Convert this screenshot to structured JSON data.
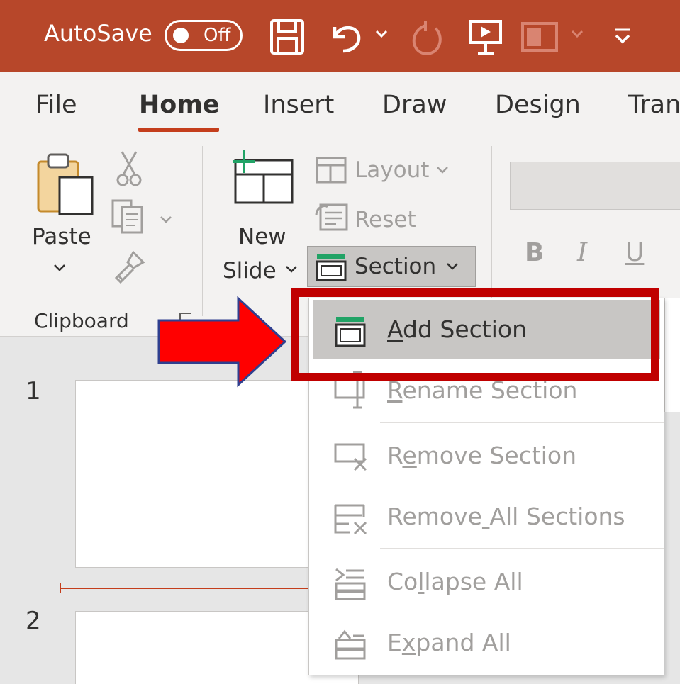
{
  "titlebar": {
    "autosave_label": "AutoSave",
    "autosave_state": "Off",
    "background": "#b7472a",
    "icons": [
      "save-icon",
      "undo-icon",
      "redo-icon",
      "present-icon",
      "layout-icon",
      "customize-icon"
    ]
  },
  "tabs": [
    {
      "label": "File",
      "active": false
    },
    {
      "label": "Home",
      "active": true
    },
    {
      "label": "Insert",
      "active": false
    },
    {
      "label": "Draw",
      "active": false
    },
    {
      "label": "Design",
      "active": false
    },
    {
      "label": "Tran",
      "active": false
    }
  ],
  "ribbon": {
    "clipboard": {
      "paste_label": "Paste",
      "group_label": "Clipboard"
    },
    "slides": {
      "new_slide_line1": "New",
      "new_slide_line2": "Slide",
      "layout_label": "Layout",
      "reset_label": "Reset",
      "section_label": "Section"
    },
    "font": {
      "bold": "B",
      "italic": "I",
      "underline": "U"
    }
  },
  "slides": [
    {
      "number": "1"
    },
    {
      "number": "2"
    }
  ],
  "section_menu": {
    "items": [
      {
        "label": "Add Section",
        "enabled": true,
        "highlighted": true
      },
      {
        "label": "Rename Section",
        "enabled": false
      },
      {
        "label": "Remove Section",
        "enabled": false
      },
      {
        "label": "Remove All Sections",
        "enabled": false
      },
      {
        "label": "Collapse All",
        "enabled": false
      },
      {
        "label": "Expand All",
        "enabled": false
      }
    ]
  },
  "colors": {
    "accent": "#c43e1c",
    "annotation": "#c00000",
    "arrow_fill": "#ff0000",
    "arrow_border": "#2f3f8f",
    "disabled_text": "#a19f9d"
  }
}
